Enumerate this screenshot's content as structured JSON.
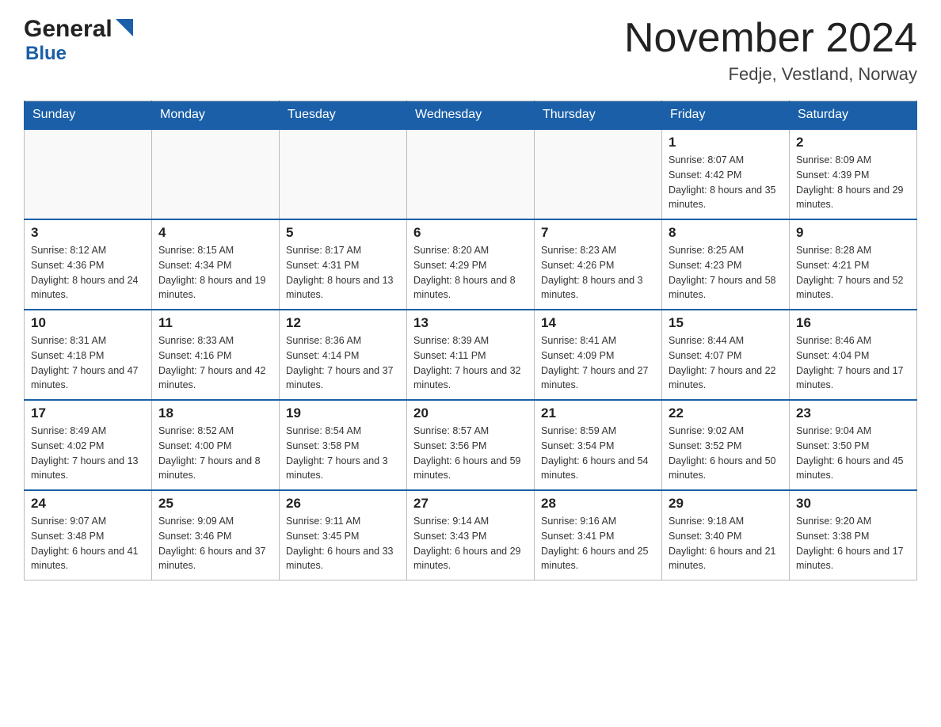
{
  "header": {
    "logo": {
      "name_part1": "General",
      "name_part2": "Blue"
    },
    "month_title": "November 2024",
    "location": "Fedje, Vestland, Norway"
  },
  "days_of_week": [
    "Sunday",
    "Monday",
    "Tuesday",
    "Wednesday",
    "Thursday",
    "Friday",
    "Saturday"
  ],
  "weeks": [
    [
      {
        "day": "",
        "info": ""
      },
      {
        "day": "",
        "info": ""
      },
      {
        "day": "",
        "info": ""
      },
      {
        "day": "",
        "info": ""
      },
      {
        "day": "",
        "info": ""
      },
      {
        "day": "1",
        "info": "Sunrise: 8:07 AM\nSunset: 4:42 PM\nDaylight: 8 hours and 35 minutes."
      },
      {
        "day": "2",
        "info": "Sunrise: 8:09 AM\nSunset: 4:39 PM\nDaylight: 8 hours and 29 minutes."
      }
    ],
    [
      {
        "day": "3",
        "info": "Sunrise: 8:12 AM\nSunset: 4:36 PM\nDaylight: 8 hours and 24 minutes."
      },
      {
        "day": "4",
        "info": "Sunrise: 8:15 AM\nSunset: 4:34 PM\nDaylight: 8 hours and 19 minutes."
      },
      {
        "day": "5",
        "info": "Sunrise: 8:17 AM\nSunset: 4:31 PM\nDaylight: 8 hours and 13 minutes."
      },
      {
        "day": "6",
        "info": "Sunrise: 8:20 AM\nSunset: 4:29 PM\nDaylight: 8 hours and 8 minutes."
      },
      {
        "day": "7",
        "info": "Sunrise: 8:23 AM\nSunset: 4:26 PM\nDaylight: 8 hours and 3 minutes."
      },
      {
        "day": "8",
        "info": "Sunrise: 8:25 AM\nSunset: 4:23 PM\nDaylight: 7 hours and 58 minutes."
      },
      {
        "day": "9",
        "info": "Sunrise: 8:28 AM\nSunset: 4:21 PM\nDaylight: 7 hours and 52 minutes."
      }
    ],
    [
      {
        "day": "10",
        "info": "Sunrise: 8:31 AM\nSunset: 4:18 PM\nDaylight: 7 hours and 47 minutes."
      },
      {
        "day": "11",
        "info": "Sunrise: 8:33 AM\nSunset: 4:16 PM\nDaylight: 7 hours and 42 minutes."
      },
      {
        "day": "12",
        "info": "Sunrise: 8:36 AM\nSunset: 4:14 PM\nDaylight: 7 hours and 37 minutes."
      },
      {
        "day": "13",
        "info": "Sunrise: 8:39 AM\nSunset: 4:11 PM\nDaylight: 7 hours and 32 minutes."
      },
      {
        "day": "14",
        "info": "Sunrise: 8:41 AM\nSunset: 4:09 PM\nDaylight: 7 hours and 27 minutes."
      },
      {
        "day": "15",
        "info": "Sunrise: 8:44 AM\nSunset: 4:07 PM\nDaylight: 7 hours and 22 minutes."
      },
      {
        "day": "16",
        "info": "Sunrise: 8:46 AM\nSunset: 4:04 PM\nDaylight: 7 hours and 17 minutes."
      }
    ],
    [
      {
        "day": "17",
        "info": "Sunrise: 8:49 AM\nSunset: 4:02 PM\nDaylight: 7 hours and 13 minutes."
      },
      {
        "day": "18",
        "info": "Sunrise: 8:52 AM\nSunset: 4:00 PM\nDaylight: 7 hours and 8 minutes."
      },
      {
        "day": "19",
        "info": "Sunrise: 8:54 AM\nSunset: 3:58 PM\nDaylight: 7 hours and 3 minutes."
      },
      {
        "day": "20",
        "info": "Sunrise: 8:57 AM\nSunset: 3:56 PM\nDaylight: 6 hours and 59 minutes."
      },
      {
        "day": "21",
        "info": "Sunrise: 8:59 AM\nSunset: 3:54 PM\nDaylight: 6 hours and 54 minutes."
      },
      {
        "day": "22",
        "info": "Sunrise: 9:02 AM\nSunset: 3:52 PM\nDaylight: 6 hours and 50 minutes."
      },
      {
        "day": "23",
        "info": "Sunrise: 9:04 AM\nSunset: 3:50 PM\nDaylight: 6 hours and 45 minutes."
      }
    ],
    [
      {
        "day": "24",
        "info": "Sunrise: 9:07 AM\nSunset: 3:48 PM\nDaylight: 6 hours and 41 minutes."
      },
      {
        "day": "25",
        "info": "Sunrise: 9:09 AM\nSunset: 3:46 PM\nDaylight: 6 hours and 37 minutes."
      },
      {
        "day": "26",
        "info": "Sunrise: 9:11 AM\nSunset: 3:45 PM\nDaylight: 6 hours and 33 minutes."
      },
      {
        "day": "27",
        "info": "Sunrise: 9:14 AM\nSunset: 3:43 PM\nDaylight: 6 hours and 29 minutes."
      },
      {
        "day": "28",
        "info": "Sunrise: 9:16 AM\nSunset: 3:41 PM\nDaylight: 6 hours and 25 minutes."
      },
      {
        "day": "29",
        "info": "Sunrise: 9:18 AM\nSunset: 3:40 PM\nDaylight: 6 hours and 21 minutes."
      },
      {
        "day": "30",
        "info": "Sunrise: 9:20 AM\nSunset: 3:38 PM\nDaylight: 6 hours and 17 minutes."
      }
    ]
  ]
}
